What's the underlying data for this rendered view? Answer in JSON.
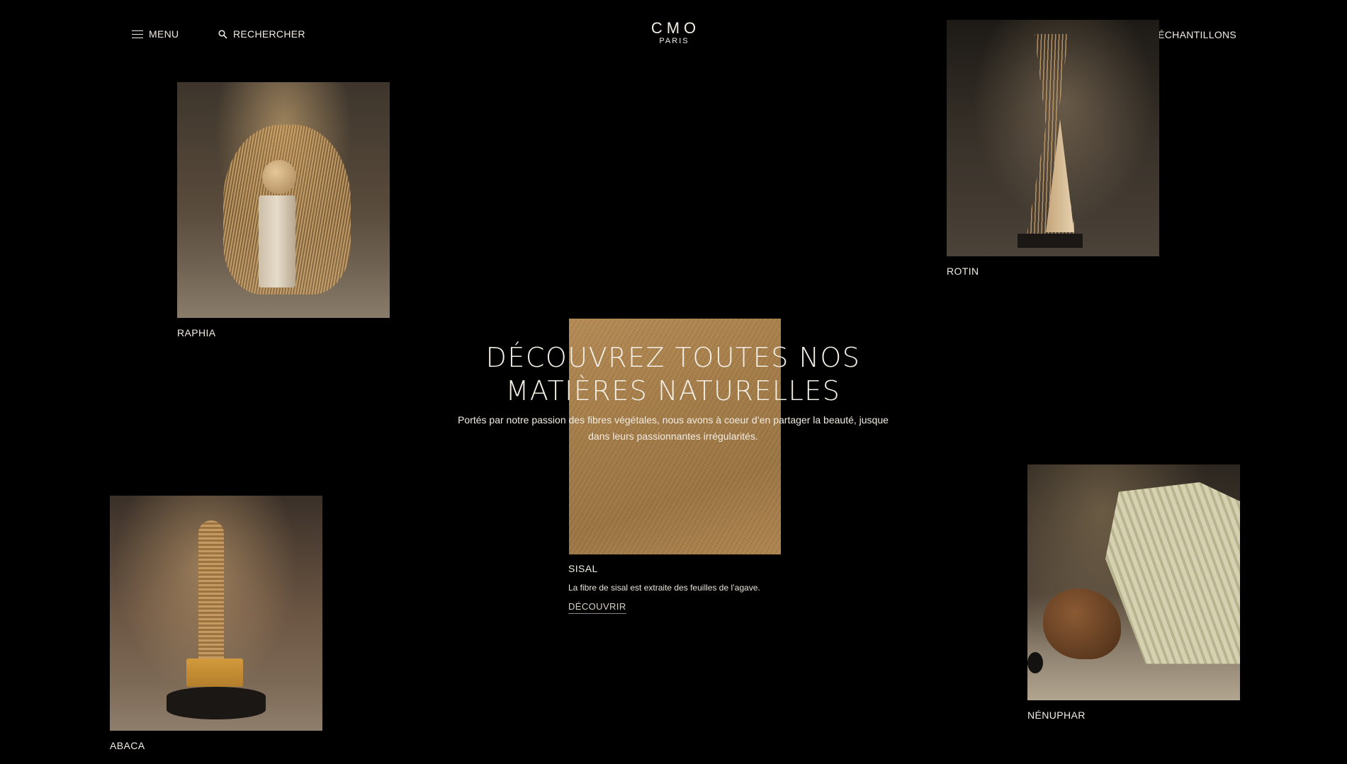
{
  "header": {
    "menu_label": "MENU",
    "search_label": "RECHERCHER",
    "logo_main": "CMO",
    "logo_sub": "PARIS",
    "samples_label": "DEMANDE D’ÉCHANTILLONS"
  },
  "hero": {
    "title_line1": "DÉCOUVREZ TOUTES NOS",
    "title_line2": "MATIÈRES NATURELLES",
    "subtitle_line1": "Portés par notre passion des fibres végétales, nous avons à coeur d’en partager la beauté, jusque",
    "subtitle_line2": "dans leurs passionnantes irrégularités."
  },
  "materials": {
    "raphia": {
      "label": "RAPHIA"
    },
    "rotin": {
      "label": "ROTIN"
    },
    "sisal": {
      "label": "SISAL",
      "description": "La fibre de sisal est extraite des feuilles de l’agave.",
      "cta": "DÉCOUVRIR"
    },
    "abaca": {
      "label": "ABACA"
    },
    "nenuphar": {
      "label": "NÉNUPHAR"
    }
  },
  "colors": {
    "background": "#000000",
    "text": "#f2ece2"
  }
}
